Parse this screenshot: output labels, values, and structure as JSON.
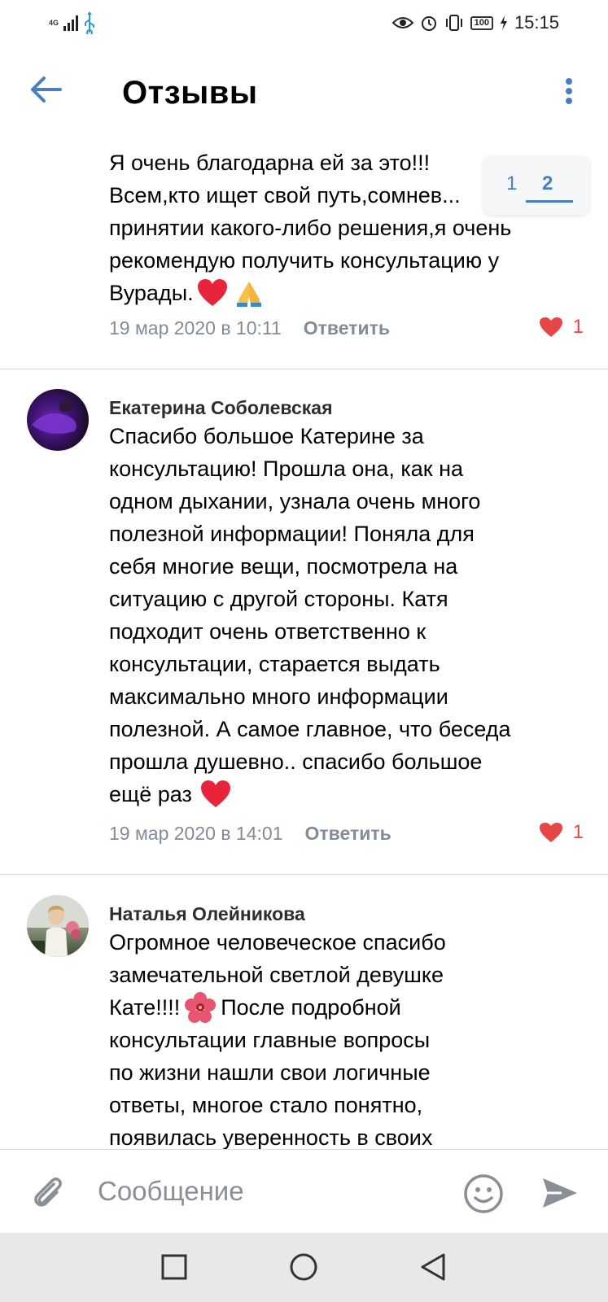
{
  "status_bar": {
    "network": "4G",
    "battery": "100",
    "time": "15:15"
  },
  "header": {
    "title": "Отзывы"
  },
  "pager": {
    "pages": [
      "1",
      "2"
    ],
    "active": "2"
  },
  "comments": [
    {
      "author": "",
      "text_lines": [
        "Я  очень благодарна ей за это!!!",
        "Всем,кто ищет свой путь,сомнев...",
        "принятии какого-либо решения,я очень",
        "рекомендую получить консультацию у",
        "Вурады."
      ],
      "date": "19 мар 2020 в 10:11",
      "reply_label": "Ответить",
      "likes": "1"
    },
    {
      "author": "Екатерина Соболевская",
      "text_lines": [
        "Спасибо большое Катерине за",
        "консультацию! Прошла она, как на",
        "одном дыхании, узнала очень много",
        "полезной информации! Поняла для",
        "себя многие вещи, посмотрела на",
        "ситуацию с другой стороны. Катя",
        "подходит очень ответственно к",
        "консультации, старается выдать",
        "максимально много информации",
        "полезной. А самое главное, что беседа",
        "прошла душевно.. спасибо большое",
        "ещё раз"
      ],
      "date": "19 мар 2020 в 14:01",
      "reply_label": "Ответить",
      "likes": "1"
    },
    {
      "author": "Наталья Олейникова",
      "text_lines": [
        "Огромное человеческое спасибо",
        "замечательной светлой девушке",
        "Кате!!!! ",
        " После подробной",
        "консультации главные вопросы",
        "по жизни нашли свои логичные",
        "ответы, многое стало понятно,",
        "появилась уверенность в своих"
      ]
    }
  ],
  "composer": {
    "placeholder": "Сообщение"
  },
  "colors": {
    "accent": "#4a7fbf",
    "meta": "#818c99",
    "like": "#e64646"
  }
}
